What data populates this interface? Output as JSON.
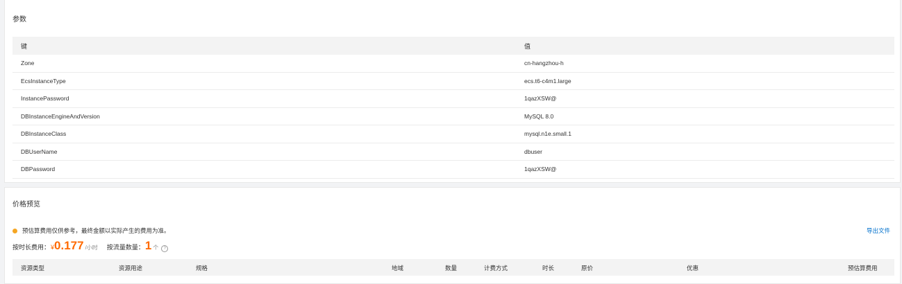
{
  "params": {
    "title": "参数",
    "header": {
      "key": "键",
      "value": "值"
    },
    "rows": [
      {
        "key": "Zone",
        "value": "cn-hangzhou-h"
      },
      {
        "key": "EcsInstanceType",
        "value": "ecs.t6-c4m1.large"
      },
      {
        "key": "InstancePassword",
        "value": "1qazXSW@"
      },
      {
        "key": "DBInstanceEngineAndVersion",
        "value": "MySQL 8.0"
      },
      {
        "key": "DBInstanceClass",
        "value": "mysql.n1e.small.1"
      },
      {
        "key": "DBUserName",
        "value": "dbuser"
      },
      {
        "key": "DBPassword",
        "value": "1qazXSW@"
      }
    ]
  },
  "price": {
    "title": "价格预览",
    "notice": "预估算费用仅供参考，最终金额以实际产生的费用为准。",
    "export_label": "导出文件",
    "hourly_label": "按时长费用：",
    "currency": "¥",
    "hourly_value": "0.177",
    "hourly_unit": "/小时",
    "flow_label": "按流量数量：",
    "flow_value": "1",
    "flow_unit": "个",
    "help_glyph": "?",
    "columns": [
      "资源类型",
      "资源用途",
      "规格",
      "地域",
      "数量",
      "计费方式",
      "时长",
      "原价",
      "优惠",
      "预估算费用"
    ]
  },
  "colors": {
    "accent_orange": "#ff6a00",
    "notice_dot": "#f5a623",
    "link_blue": "#0070cc"
  }
}
